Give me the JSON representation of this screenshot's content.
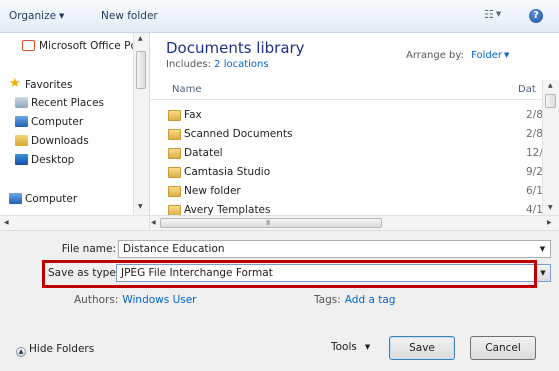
{
  "toolbar": {
    "organize": "Organize",
    "new_folder": "New folder",
    "help": "?"
  },
  "nav": {
    "top_item": "Microsoft Office Pc",
    "favorites": "Favorites",
    "items": [
      "Recent Places",
      "Computer",
      "Downloads",
      "Desktop"
    ],
    "computer": "Computer"
  },
  "library": {
    "title": "Documents library",
    "includes_label": "Includes:",
    "includes_link": "2 locations",
    "arrange_label": "Arrange by:",
    "arrange_value": "Folder"
  },
  "columns": {
    "name": "Name",
    "date": "Dat"
  },
  "files": [
    {
      "name": "Fax",
      "date": "2/8/"
    },
    {
      "name": "Scanned Documents",
      "date": "2/8/"
    },
    {
      "name": "Datatel",
      "date": "12/:"
    },
    {
      "name": "Camtasia Studio",
      "date": "9/2"
    },
    {
      "name": "New folder",
      "date": "6/1/"
    },
    {
      "name": "Avery Templates",
      "date": "4/1("
    }
  ],
  "scroll_grip": "III",
  "form": {
    "file_name_label": "File name:",
    "file_name_value": "Distance Education",
    "save_type_label": "Save as type:",
    "save_type_value": "JPEG File Interchange Format",
    "authors_label": "Authors:",
    "authors_value": "Windows User",
    "tags_label": "Tags:",
    "tags_value": "Add a tag"
  },
  "footer": {
    "hide_folders": "Hide Folders",
    "tools": "Tools",
    "save": "Save",
    "cancel": "Cancel"
  },
  "colors": {
    "highlight": "#c00000",
    "link": "#0066cc",
    "library_title": "#1e3287"
  }
}
